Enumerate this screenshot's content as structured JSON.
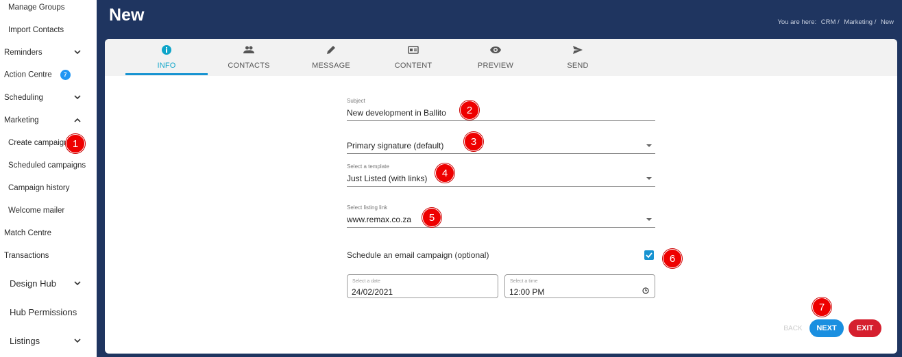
{
  "sidebar": {
    "items": [
      {
        "label": "Manage Groups"
      },
      {
        "label": "Import Contacts"
      },
      {
        "label": "Reminders"
      },
      {
        "label": "Action Centre",
        "badge": "7"
      },
      {
        "label": "Scheduling"
      },
      {
        "label": "Marketing"
      },
      {
        "label": "Create campaign"
      },
      {
        "label": "Scheduled campaigns"
      },
      {
        "label": "Campaign history"
      },
      {
        "label": "Welcome mailer"
      },
      {
        "label": "Match Centre"
      },
      {
        "label": "Transactions"
      },
      {
        "label": "Design Hub"
      },
      {
        "label": "Hub Permissions"
      },
      {
        "label": "Listings"
      }
    ]
  },
  "header": {
    "title": "New",
    "breadcrumb": {
      "prefix": "You are here:",
      "items": [
        "CRM /",
        "Marketing /",
        "New"
      ]
    }
  },
  "tabs": [
    {
      "label": "INFO",
      "icon": "info-icon",
      "active": true
    },
    {
      "label": "CONTACTS",
      "icon": "people-icon"
    },
    {
      "label": "MESSAGE",
      "icon": "pencil-icon"
    },
    {
      "label": "CONTENT",
      "icon": "content-icon"
    },
    {
      "label": "PREVIEW",
      "icon": "eye-icon"
    },
    {
      "label": "SEND",
      "icon": "send-icon"
    }
  ],
  "form": {
    "subject": {
      "label": "Subject",
      "value": "New development in Ballito"
    },
    "signature": {
      "value": "Primary signature (default)"
    },
    "template": {
      "label": "Select a template",
      "value": "Just Listed (with links)"
    },
    "listing_link": {
      "label": "Select listing link",
      "value": "www.remax.co.za"
    },
    "schedule": {
      "label": "Schedule an email campaign (optional)",
      "checked": true
    },
    "date": {
      "label": "Select a date",
      "value": "24/02/2021"
    },
    "time": {
      "label": "Select a time",
      "value": "12:00 PM"
    }
  },
  "buttons": {
    "back": "BACK",
    "next": "NEXT",
    "exit": "EXIT"
  },
  "markers": [
    "1",
    "2",
    "3",
    "4",
    "5",
    "6",
    "7"
  ],
  "colors": {
    "header_bg": "#1f3560",
    "accent": "#1793d1",
    "next": "#1a8fe0",
    "exit": "#d51f2e",
    "marker": "#ee0000",
    "badge": "#2196f3"
  }
}
